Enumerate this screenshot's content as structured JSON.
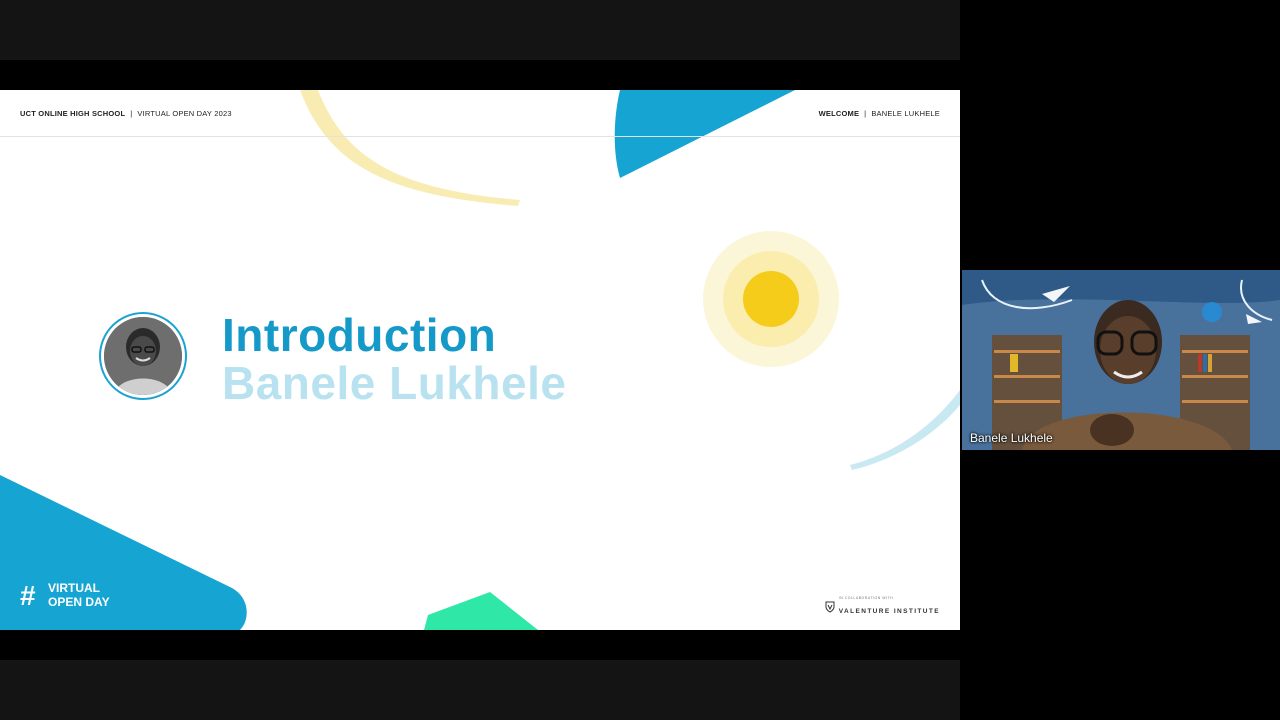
{
  "slide": {
    "header": {
      "left_bold": "UCT ONLINE HIGH SCHOOL",
      "separator": "|",
      "left_rest": "VIRTUAL OPEN DAY 2023",
      "right_bold": "WELCOME",
      "right_rest": "BANELE LUKHELE"
    },
    "title": "Introduction",
    "subtitle": "Banele Lukhele",
    "hashtag": "#",
    "badge_line1": "VIRTUAL",
    "badge_line2": "OPEN DAY",
    "logo_small": "IN COLLABORATION WITH",
    "logo_text": "VALENTURE INSTITUTE",
    "colors": {
      "primary": "#1599c9",
      "light": "#b8e2ef",
      "sun": "#f5cc1a",
      "green": "#2fe8a8",
      "arc": "#f8ecb0"
    }
  },
  "video": {
    "participant_name": "Banele Lukhele"
  }
}
